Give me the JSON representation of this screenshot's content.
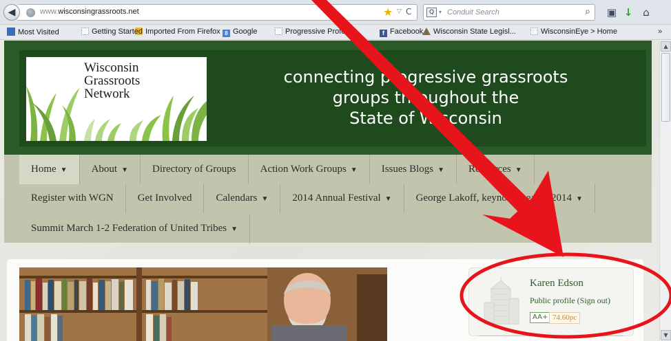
{
  "browser": {
    "back_glyph": "◀",
    "url_prefix": "www.",
    "url_host": "wisconsingrassroots.net",
    "star_glyph": "★",
    "dropdown_glyph": "▽",
    "reload_glyph": "C",
    "search_placeholder": "Conduit Search",
    "search_caret": "▾",
    "magnifier_glyph": "⌕",
    "toolbar_glyph": "▣",
    "download_glyph": "↓",
    "home_glyph": "⌂",
    "scroll_up": "▲",
    "scroll_down": "▼",
    "bookmarks_more": "»"
  },
  "bookmarks": [
    {
      "label": "Most Visited",
      "icon": "special-icon"
    },
    {
      "label": "Getting Started",
      "icon": "page-icon"
    },
    {
      "label": "Imported From Firefox",
      "icon": "folder-icon"
    },
    {
      "label": "Google",
      "icon": "google-icon"
    },
    {
      "label": "Progressive Profess...",
      "icon": "page-icon"
    },
    {
      "label": "Facebook",
      "icon": "facebook-icon"
    },
    {
      "label": "Wisconsin State Legisl...",
      "icon": "capitol-icon"
    },
    {
      "label": "WisconsinEye > Home",
      "icon": "page-icon"
    }
  ],
  "site": {
    "logo_lines": [
      "Wisconsin",
      "Grassroots",
      "Network"
    ],
    "tagline_lines": [
      "connecting progressive grassroots",
      "groups throughout the",
      "State of Wisconsin"
    ]
  },
  "menu": {
    "row1": [
      {
        "label": "Home",
        "caret": "▼",
        "active": true
      },
      {
        "label": "About",
        "caret": "▼"
      },
      {
        "label": "Directory of Groups",
        "caret": ""
      },
      {
        "label": "Action Work Groups",
        "caret": "▼"
      },
      {
        "label": "Issues Blogs",
        "caret": "▼"
      },
      {
        "label": "Resources",
        "caret": "▼"
      }
    ],
    "row2": [
      {
        "label": "Register with WGN",
        "caret": ""
      },
      {
        "label": "Get Involved",
        "caret": ""
      },
      {
        "label": "Calendars",
        "caret": "▼"
      },
      {
        "label": "2014 Annual Festival",
        "caret": "▼"
      },
      {
        "label": "George Lakoff, keynote speaker 2014",
        "caret": "▼"
      }
    ],
    "row3": [
      {
        "label": "Summit March 1-2 Federation of United Tribes",
        "caret": "▼"
      }
    ]
  },
  "profile": {
    "name": "Karen Edson",
    "public_profile": "Public profile",
    "sign_out": "(Sign out)",
    "font_resize": "AA+",
    "pc_value": "74.60pc"
  },
  "colors": {
    "annotation_red": "#e8141b",
    "header_green": "#1f4a1d",
    "menu_bg": "#c3c4ae"
  }
}
